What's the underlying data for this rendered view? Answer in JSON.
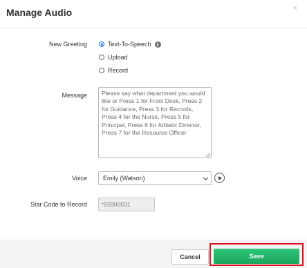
{
  "dialog": {
    "title": "Manage Audio",
    "close_glyph": "×"
  },
  "form": {
    "new_greeting": {
      "label": "New Greeting",
      "options": [
        {
          "label": "Text-To-Speech",
          "selected": true
        },
        {
          "label": "Upload",
          "selected": false
        },
        {
          "label": "Record",
          "selected": false
        }
      ],
      "info_glyph": "i"
    },
    "message": {
      "label": "Message",
      "value": "Please say what department you would like or Press 1 for Front Desk, Press 2 for Guidance, Press 3 for Records, Press 4 for the Nurse, Press 5 for Principal, Press 6 for Athletic Director, Press 7 for the Resource Officer"
    },
    "voice": {
      "label": "Voice",
      "selected": "Emily (Watson)"
    },
    "star_code": {
      "label": "Star Code to Record",
      "value": "*55900501"
    }
  },
  "footer": {
    "cancel_label": "Cancel",
    "save_label": "Save"
  },
  "colors": {
    "save_button": "#1aa45c",
    "highlight_box": "#d9121b",
    "radio_selected": "#1a73e8"
  },
  "icons": [
    "info-icon",
    "play-icon",
    "chevron-down-icon",
    "close-icon"
  ]
}
